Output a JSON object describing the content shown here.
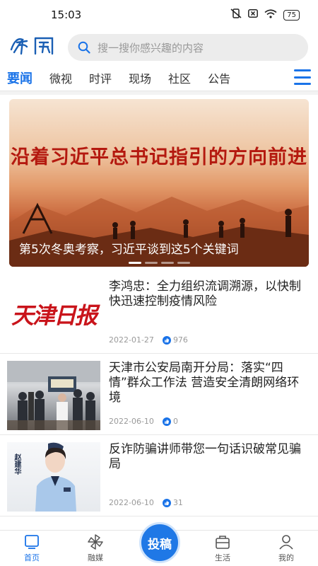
{
  "status_bar": {
    "time": "15:03",
    "battery": "75"
  },
  "header": {
    "logo_text": "南开",
    "search_placeholder": "搜一搜你感兴趣的内容"
  },
  "tabs": [
    {
      "label": "要闻",
      "active": true
    },
    {
      "label": "微视"
    },
    {
      "label": "时评"
    },
    {
      "label": "现场"
    },
    {
      "label": "社区"
    },
    {
      "label": "公告"
    }
  ],
  "banner": {
    "headline": "沿着习近平总书记指引的方向前进",
    "caption": "第5次冬奥考察，习近平谈到这5个关键词"
  },
  "news": [
    {
      "title": "李鸿忠：全力组织流调溯源，以快制快迅速控制疫情风险",
      "date": "2022-01-27",
      "likes": "976",
      "thumb_text": "天津日报"
    },
    {
      "title": "天津市公安局南开分局：落实“四情”群众工作法 营造安全清朗网络环境",
      "date": "2022-06-10",
      "likes": "0"
    },
    {
      "title": "反诈防骗讲师带您一句话识破常见骗局",
      "date": "2022-06-10",
      "likes": "31",
      "thumb_text": "赵建华"
    }
  ],
  "bottom_nav": {
    "home": "首页",
    "media": "融媒",
    "submit": "投稿",
    "life": "生活",
    "mine": "我的"
  },
  "colors": {
    "accent": "#1a73e8",
    "banner_headline": "#b4190f"
  }
}
